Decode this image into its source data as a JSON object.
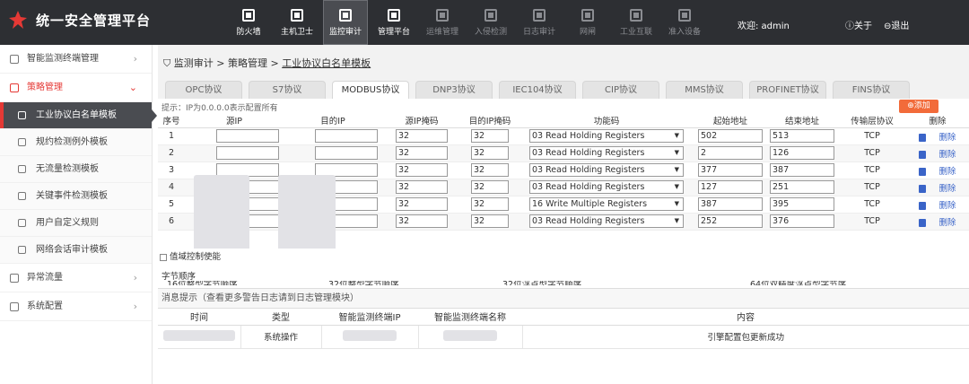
{
  "app": {
    "title": "统一安全管理平台",
    "user": "欢迎: admin",
    "about": "关于",
    "logout": "退出"
  },
  "nav": [
    {
      "label": "防火墙",
      "icon": "firewall-icon",
      "state": "normal"
    },
    {
      "label": "主机卫士",
      "icon": "host-guard-icon",
      "state": "normal"
    },
    {
      "label": "监控审计",
      "icon": "monitor-audit-icon",
      "state": "active"
    },
    {
      "label": "管理平台",
      "icon": "platform-icon",
      "state": "normal"
    },
    {
      "label": "运维管理",
      "icon": "ops-icon",
      "state": "dim"
    },
    {
      "label": "入侵检测",
      "icon": "ids-icon",
      "state": "dim"
    },
    {
      "label": "日志审计",
      "icon": "log-audit-icon",
      "state": "dim"
    },
    {
      "label": "网闸",
      "icon": "gateway-icon",
      "state": "dim"
    },
    {
      "label": "工业互联",
      "icon": "industrial-icon",
      "state": "dim"
    },
    {
      "label": "准入设备",
      "icon": "access-device-icon",
      "state": "dim"
    }
  ],
  "sidebar": {
    "items": [
      {
        "label": "智能监测终端管理",
        "icon": "network-icon",
        "kind": "group",
        "chevron": "›"
      },
      {
        "label": "策略管理",
        "icon": "list-icon",
        "kind": "group-open",
        "chevron": "⌄"
      },
      {
        "label": "工业协议白名单模板",
        "icon": "template-icon",
        "kind": "sub-active"
      },
      {
        "label": "规约检测例外模板",
        "icon": "exception-icon",
        "kind": "sub"
      },
      {
        "label": "无流量检测模板",
        "icon": "wifi-icon",
        "kind": "sub"
      },
      {
        "label": "关键事件检测模板",
        "icon": "event-icon",
        "kind": "sub"
      },
      {
        "label": "用户自定义规则",
        "icon": "user-rule-icon",
        "kind": "sub"
      },
      {
        "label": "网络会话审计模板",
        "icon": "session-icon",
        "kind": "sub"
      },
      {
        "label": "异常流量",
        "icon": "warning-icon",
        "kind": "group",
        "chevron": "›"
      },
      {
        "label": "系统配置",
        "icon": "gear-icon",
        "kind": "group",
        "chevron": "›"
      }
    ]
  },
  "breadcrumb": {
    "part1": "监测审计",
    "sep": " > ",
    "part2": "策略管理",
    "current": "工业协议白名单模板"
  },
  "tabs": [
    "OPC协议",
    "S7协议",
    "MODBUS协议",
    "DNP3协议",
    "IEC104协议",
    "CIP协议",
    "MMS协议",
    "PROFINET协议",
    "FINS协议"
  ],
  "active_tab": "MODBUS协议",
  "hint": "提示：IP为0.0.0.0表示配置所有",
  "add_label": "添加",
  "table": {
    "columns": [
      "序号",
      "源IP",
      "目的IP",
      "源IP掩码",
      "目的IP掩码",
      "功能码",
      "起始地址",
      "结束地址",
      "传输层协议",
      "删除"
    ],
    "delete_label": "删除",
    "rows": [
      {
        "no": "1",
        "src_mask": "32",
        "dst_mask": "32",
        "func": "03 Read Holding Registers",
        "start": "502",
        "end": "513",
        "proto": "TCP"
      },
      {
        "no": "2",
        "src_mask": "32",
        "dst_mask": "32",
        "func": "03 Read Holding Registers",
        "start": "2",
        "end": "126",
        "proto": "TCP"
      },
      {
        "no": "3",
        "src_mask": "32",
        "dst_mask": "32",
        "func": "03 Read Holding Registers",
        "start": "377",
        "end": "387",
        "proto": "TCP"
      },
      {
        "no": "4",
        "src_mask": "32",
        "dst_mask": "32",
        "func": "03 Read Holding Registers",
        "start": "127",
        "end": "251",
        "proto": "TCP"
      },
      {
        "no": "5",
        "src_mask": "32",
        "dst_mask": "32",
        "func": "16 Write Multiple Registers",
        "start": "387",
        "end": "395",
        "proto": "TCP"
      },
      {
        "no": "6",
        "src_mask": "32",
        "dst_mask": "32",
        "func": "03 Read Holding Registers",
        "start": "252",
        "end": "376",
        "proto": "TCP"
      }
    ]
  },
  "threshold_label": "值域控制使能",
  "byte_order": {
    "label": "字节顺序",
    "opt1": "16位整型字节顺序",
    "opt2": "32位整型字节顺序",
    "opt3": "32位浮点型字节顺序",
    "opt4": "64位双精度浮点型字节序"
  },
  "messages": {
    "title": "消息提示（查看更多警告日志请到日志管理模块）",
    "columns": [
      "时间",
      "类型",
      "智能监测终端IP",
      "智能监测终端名称",
      "内容"
    ],
    "rows": [
      {
        "type": "系统操作",
        "content": "引擎配置包更新成功"
      }
    ]
  },
  "colors": {
    "topbar": "#2d2f33",
    "accent": "#e53935",
    "add_button": "#f26b3a",
    "link": "#3a64c8"
  }
}
